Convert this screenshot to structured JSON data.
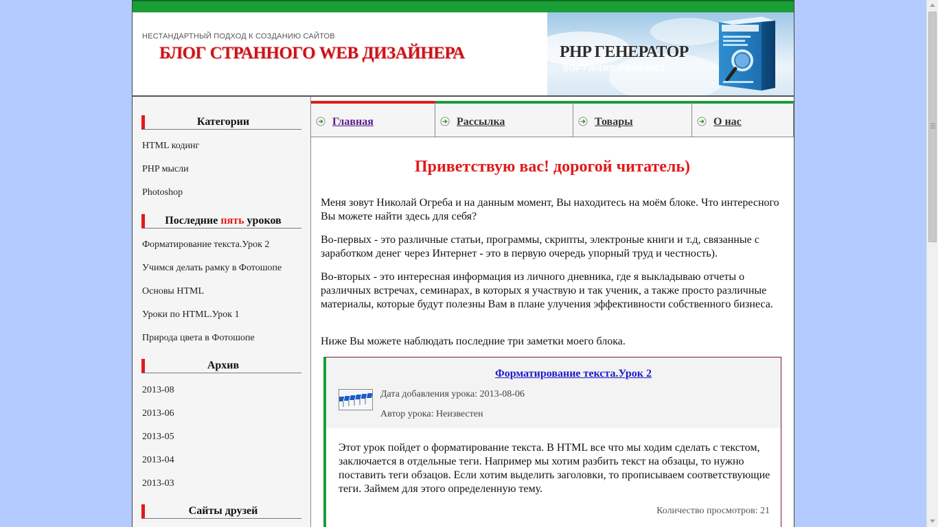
{
  "header": {
    "tagline": "НЕСТАНДАРТНЫЙ ПОДХОД К СОЗДАНИЮ САЙТОВ",
    "blog_title": "БЛОГ СТРАННОГО WEB ДИЗАЙНЕРА",
    "promo_title": "PHP ГЕНЕРАТОР",
    "promo_subtitle": "SOFTWARE PRODUCT"
  },
  "sidebar": {
    "categories": {
      "title": "Категории",
      "items": [
        "HTML кодинг",
        "PHP мысли",
        "Photoshop"
      ]
    },
    "recent": {
      "title_prefix": "Последние ",
      "title_highlight": "пять",
      "title_suffix": " уроков",
      "items": [
        "Форматирование текста.Урок 2",
        "Учимся делать рамку в Фотошопе",
        "Основы HTML",
        "Уроки по HTML.Урок 1",
        "Природа цвета в Фотошопе"
      ]
    },
    "archive": {
      "title": "Архив",
      "items": [
        "2013-08",
        "2013-06",
        "2013-05",
        "2013-04",
        "2013-03"
      ]
    },
    "friends": {
      "title": "Сайты друзей"
    }
  },
  "nav": {
    "tabs": [
      {
        "label": "Главная",
        "icon": "arrow-right-circle-icon"
      },
      {
        "label": "Рассылка",
        "icon": "arrow-right-circle-icon"
      },
      {
        "label": "Товары",
        "icon": "arrow-right-circle-icon"
      },
      {
        "label": "О нас",
        "icon": "arrow-right-circle-icon"
      }
    ]
  },
  "main": {
    "welcome": "Приветствую вас! дорогой читатель)",
    "paragraphs": [
      "Меня зовут Николай Огреба и на данным момент, Вы находитесь на моём блоке. Что интересного Вы можете найти здесь для себя?",
      "Во-первых - это различные статьи, программы, скрипты, электроные книги и т.д, связанные с заработком денег через Интернет - это в первую очередь упорный труд и честность).",
      "Во-вторых - это интересная информация из личного дневника, где я выкладываю отчеты о различных встречах, семинарах, в которых я участвую и так ученик, а также просто различные материалы, которые будут полезны Вам в плане улучения эффективности собственного бизнеса.",
      "Ниже Вы можете наблюдать последние три заметки моего блока."
    ],
    "card": {
      "title": "Форматирование текста.Урок 2",
      "date": "Дата добавления урока: 2013-08-06",
      "author": "Автор урока: Неизвестен",
      "body": "Этот урок пойдет о форматирование текста. В HTML все что мы ходим сделать с текстом, заключается в отдельные теги. Например мы хотим разбить текст на обзацы, то нужно поставить теги обзацов. Если хотим выделить заголовки, то прописываем соответствующие теги. Займем для этого определенную тему.",
      "views": "Количество просмотров: 21"
    }
  },
  "colors": {
    "accent_red": "#e21a1a",
    "accent_green": "#1a9e36",
    "page_bg": "#b3cbff"
  }
}
